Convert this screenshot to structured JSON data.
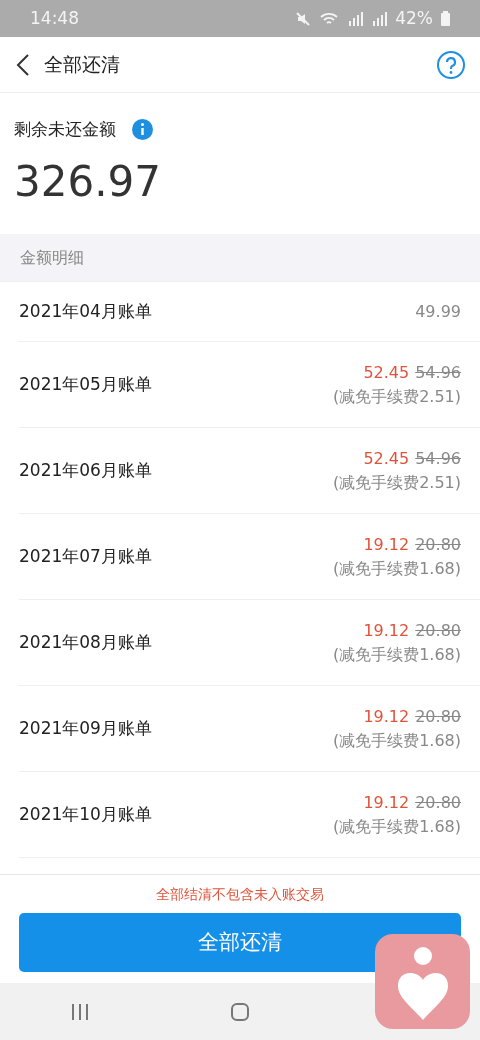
{
  "status_bar": {
    "time": "14:48",
    "battery": "42%"
  },
  "header": {
    "title": "全部还清"
  },
  "summary": {
    "label": "剩余未还金额",
    "amount": "326.97"
  },
  "section": {
    "title": "金额明细"
  },
  "bills": [
    {
      "kind": "plain",
      "name": "2021年04月账单",
      "amount": "49.99"
    },
    {
      "kind": "discounted",
      "name": "2021年05月账单",
      "amount": "52.45",
      "original": "54.96",
      "note": "(减免手续费2.51)"
    },
    {
      "kind": "discounted",
      "name": "2021年06月账单",
      "amount": "52.45",
      "original": "54.96",
      "note": "(减免手续费2.51)"
    },
    {
      "kind": "discounted",
      "name": "2021年07月账单",
      "amount": "19.12",
      "original": "20.80",
      "note": "(减免手续费1.68)"
    },
    {
      "kind": "discounted",
      "name": "2021年08月账单",
      "amount": "19.12",
      "original": "20.80",
      "note": "(减免手续费1.68)"
    },
    {
      "kind": "discounted",
      "name": "2021年09月账单",
      "amount": "19.12",
      "original": "20.80",
      "note": "(减免手续费1.68)"
    },
    {
      "kind": "discounted",
      "name": "2021年10月账单",
      "amount": "19.12",
      "original": "20.80",
      "note": "(减免手续费1.68)"
    }
  ],
  "footer": {
    "notice": "全部结清不包含未入账交易",
    "button": "全部还清"
  }
}
